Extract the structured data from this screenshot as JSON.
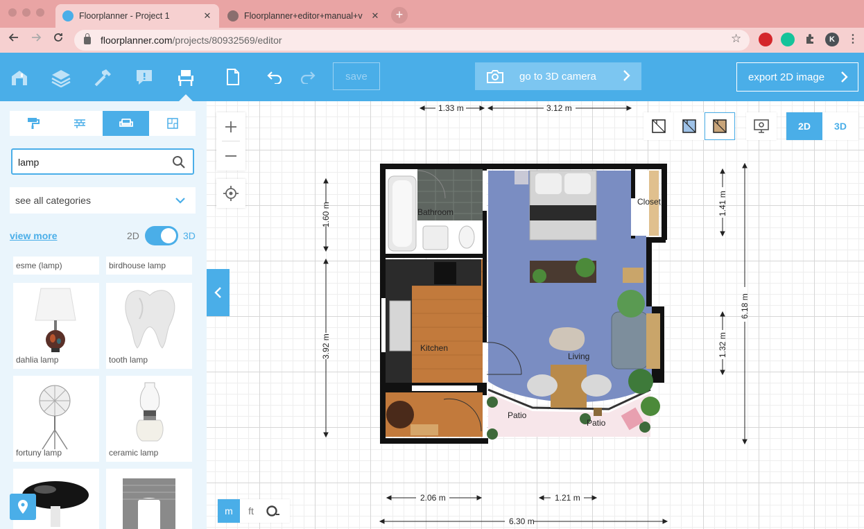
{
  "browser": {
    "tabs": [
      {
        "title": "Floorplanner - Project 1",
        "close": "✕"
      },
      {
        "title": "Floorplanner+editor+manual+v",
        "close": "✕"
      }
    ],
    "new_tab": "+",
    "url_host": "floorplanner.com",
    "url_path": "/projects/80932569/editor",
    "profile_initial": "K"
  },
  "toolbar": {
    "save_label": "save",
    "camera_label": "go to 3D camera",
    "export_label": "export 2D image"
  },
  "sidebar": {
    "search_value": "lamp",
    "category_select": "see all categories",
    "view_more": "view more",
    "toggle_2d": "2D",
    "toggle_3d": "3D",
    "items": [
      {
        "label": "esme (lamp)"
      },
      {
        "label": "birdhouse lamp"
      },
      {
        "label": "dahlia lamp"
      },
      {
        "label": "tooth lamp"
      },
      {
        "label": "fortuny lamp"
      },
      {
        "label": "ceramic lamp"
      }
    ]
  },
  "canvas": {
    "view_2d": "2D",
    "view_3d": "3D",
    "unit_m": "m",
    "unit_ft": "ft",
    "rooms": {
      "bathroom": "Bathroom",
      "closet": "Closet",
      "kitchen": "Kitchen",
      "living": "Living",
      "patio_1": "Patio",
      "patio_2": "Patio"
    },
    "dimensions": {
      "top_1": "1.33 m",
      "top_2": "3.12 m",
      "left_1": "1.60 m",
      "left_2": "3.92 m",
      "right_1": "1.41 m",
      "right_2": "1.32 m",
      "right_total": "6.18 m",
      "bottom_1": "2.06 m",
      "bottom_2": "1.21 m",
      "bottom_total": "6.30 m"
    }
  },
  "colors": {
    "accent": "#4aaee8",
    "sidebar_bg": "#eaf5fc",
    "living_floor": "#7a8dc2",
    "wood_floor": "#c27a3c",
    "patio_floor": "#f7e6ea"
  }
}
